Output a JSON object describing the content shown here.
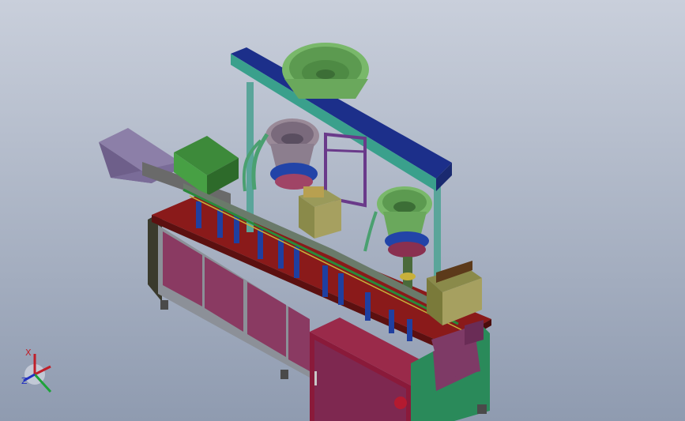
{
  "viewport": {
    "background_top": "#c9cfdb",
    "background_bottom": "#8f9bb0"
  },
  "model": {
    "colors": {
      "table_top": "#8a1a1a",
      "cabinet_panel": "#8a3a62",
      "frame_grey": "#8c9098",
      "gantry_beam": "#1c2f8a",
      "gantry_post": "#5aa59a",
      "bowl_green": "#79b86a",
      "bowl_grey": "#9a8a98",
      "chute_purple": "#8c7fa8",
      "hopper_green": "#3d8a3a",
      "cylinder_blue": "#1f3fa0"
    }
  },
  "triad": {
    "x_label": "X",
    "y_label": "Y",
    "z_label": "Z",
    "x_color": "#c0202a",
    "y_color": "#1ea23a",
    "z_color": "#2230c0"
  }
}
